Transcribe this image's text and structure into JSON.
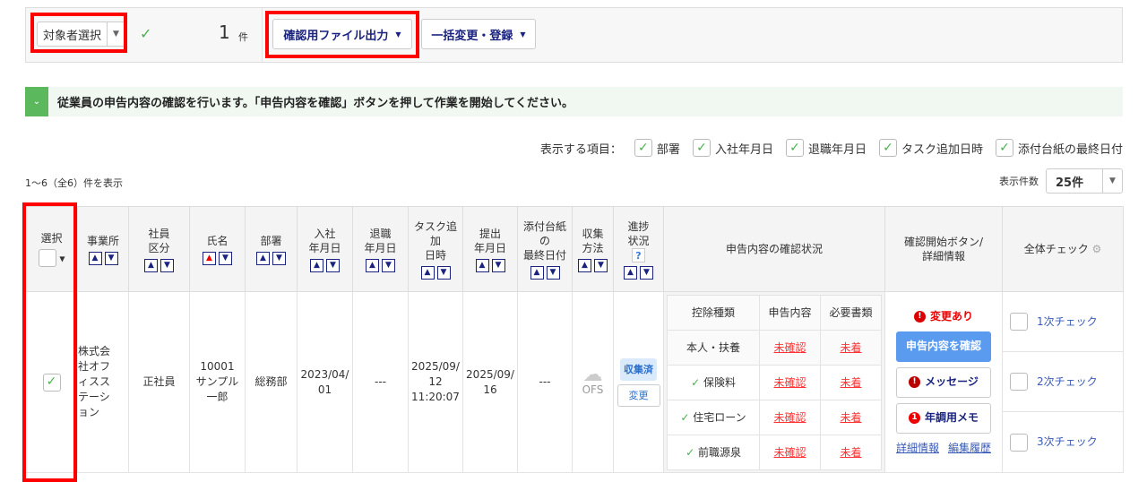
{
  "toolbar": {
    "target_select": "対象者選択",
    "count": "1",
    "count_unit": "件",
    "export_button": "確認用ファイル出力",
    "bulk_button": "一括変更・登録"
  },
  "notice": "従業員の申告内容の確認を行います。「申告内容を確認」ボタンを押して作業を開始してください。",
  "display_items": {
    "label": "表示する項目：",
    "items": [
      "部署",
      "入社年月日",
      "退職年月日",
      "タスク追加日時",
      "添付台紙の最終日付"
    ]
  },
  "range_text": "1〜6（全6）件を表示",
  "per_page": {
    "label": "表示件数",
    "value": "25件"
  },
  "columns": [
    "選択",
    "事業所",
    "社員\n区分",
    "氏名",
    "部署",
    "入社\n年月日",
    "退職\n年月日",
    "タスク追\n加\n日時",
    "提出\n年月日",
    "添付台紙\nの\n最終日付",
    "収集\n方法",
    "進捗\n状況",
    "申告内容の確認状況",
    "確認開始ボタン/\n詳細情報",
    "全体チェック"
  ],
  "row": {
    "office": "株式会\n社オフ\nィスス\nテーシ\nョン",
    "emp_type": "正社員",
    "name": "10001\nサンプル\n一郎",
    "dept": "総務部",
    "hire_date": "2023/04/\n01",
    "retire_date": "---",
    "task_date": "2025/09/\n12\n11:20:07",
    "submit_date": "2025/09/\n16",
    "attach_date": "---",
    "method": "OFS",
    "status": "収集済",
    "change_button": "変更",
    "inner_header": [
      "控除種類",
      "申告内容",
      "必要書類"
    ],
    "deductions": [
      {
        "type": "本人・扶養",
        "checked": false,
        "content": "未確認",
        "docs": "未着"
      },
      {
        "type": "保険料",
        "checked": true,
        "content": "未確認",
        "docs": "未着"
      },
      {
        "type": "住宅ローン",
        "checked": true,
        "content": "未確認",
        "docs": "未着"
      },
      {
        "type": "前職源泉",
        "checked": true,
        "content": "未確認",
        "docs": "未着"
      }
    ],
    "changed": "変更あり",
    "confirm_button": "申告内容を確認",
    "message_button": "メッセージ",
    "memo_button": "年調用メモ",
    "memo_badge": "1",
    "detail_link": "詳細情報",
    "history_link": "編集履歴",
    "checks": [
      "1次チェック",
      "2次チェック",
      "3次チェック"
    ]
  },
  "colors": {
    "accent": "#1a237e",
    "highlight": "#ff0000",
    "primary_button": "#5b9bef",
    "notice": "#5cb85c"
  }
}
